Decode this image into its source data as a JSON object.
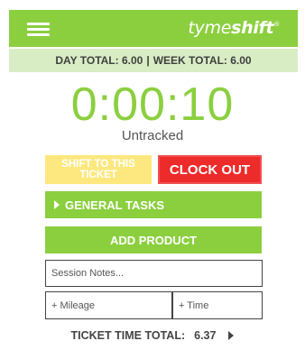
{
  "header": {
    "logo_prefix": "tyme",
    "logo_bold": "shift",
    "logo_mark": "®",
    "menu_icon": "hamburger-menu-icon",
    "background_color": "#8bcf3f"
  },
  "totals": {
    "day_label": "DAY TOTAL:",
    "day_value": "6.00",
    "separator": "|",
    "week_label": "WEEK TOTAL:",
    "week_value": "6.00"
  },
  "timer": {
    "value": "0:00:10",
    "status": "Untracked",
    "color": "#8bcf3f"
  },
  "actions": {
    "shift_label": "SHIFT TO THIS TICKET",
    "clock_out_label": "CLOCK OUT",
    "general_tasks_label": "GENERAL TASKS",
    "add_product_label": "ADD PRODUCT",
    "clock_out_color": "#ee2b2b",
    "shift_color": "#fde87f"
  },
  "fields": {
    "notes_placeholder": "Session Notes...",
    "mileage_placeholder": "+ Mileage",
    "time_placeholder": "+ Time"
  },
  "ticket_total": {
    "label": "TICKET TIME TOTAL:",
    "value": "6.37"
  }
}
